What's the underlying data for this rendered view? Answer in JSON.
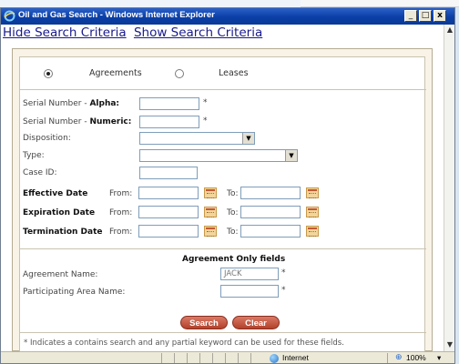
{
  "window": {
    "title": "Oil and Gas Search - Windows Internet Explorer",
    "minimize": "_",
    "maximize": "□",
    "close": "x"
  },
  "nav": {
    "hide": "Hide Search Criteria",
    "show": "Show Search Criteria"
  },
  "search_type": {
    "options": [
      "Agreements",
      "Leases"
    ],
    "selected": "Agreements"
  },
  "fields": {
    "serial_alpha_prefix": "Serial Number - ",
    "serial_alpha_bold": "Alpha:",
    "serial_numeric_prefix": "Serial Number - ",
    "serial_numeric_bold": "Numeric:",
    "disposition": "Disposition:",
    "type": "Type:",
    "case_id": "Case ID:",
    "required_mark": "*"
  },
  "dates": {
    "effective": "Effective Date",
    "expiration": "Expiration Date",
    "termination": "Termination Date",
    "from": "From:",
    "to": "To:"
  },
  "agreement_only": {
    "heading": "Agreement Only fields",
    "agreement_name_label": "Agreement Name:",
    "agreement_name_value": "JACK",
    "participating_area_label": "Participating Area Name:"
  },
  "buttons": {
    "search": "Search",
    "clear": "Clear"
  },
  "footnote": "* Indicates a contains search and any partial keyword can be used for these fields.",
  "statusbar": {
    "zone": "Internet",
    "zoom": "100%",
    "zoom_arrow": "▾"
  },
  "colors": {
    "titlebar": "#0b3fa6",
    "button": "#b2412b",
    "panel": "#f8f3e6"
  }
}
